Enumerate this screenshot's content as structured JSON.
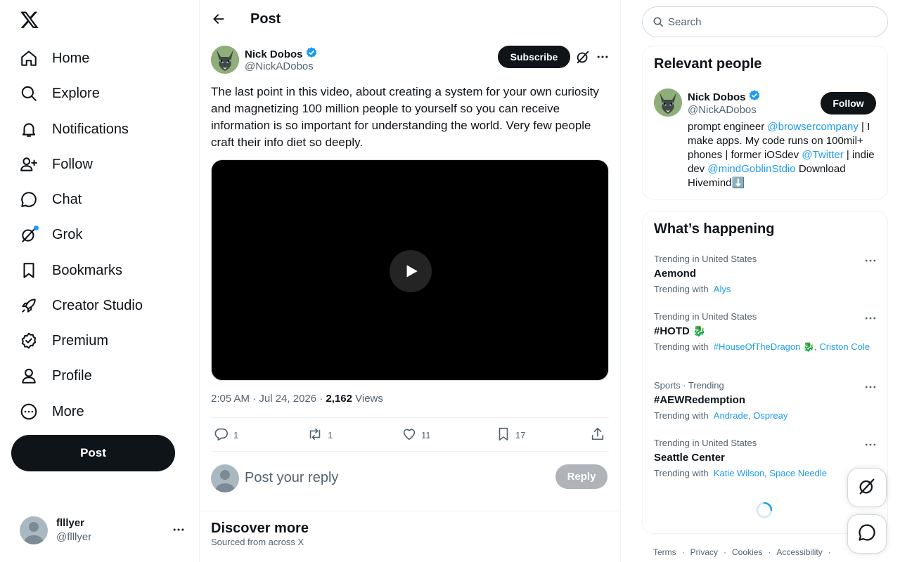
{
  "nav": {
    "logo": "x-logo",
    "items": [
      {
        "label": "Home",
        "icon": "home-icon"
      },
      {
        "label": "Explore",
        "icon": "search-icon"
      },
      {
        "label": "Notifications",
        "icon": "bell-icon"
      },
      {
        "label": "Follow",
        "icon": "person-add-icon"
      },
      {
        "label": "Chat",
        "icon": "chat-icon"
      },
      {
        "label": "Grok",
        "icon": "grok-icon"
      },
      {
        "label": "Bookmarks",
        "icon": "bookmark-icon"
      },
      {
        "label": "Creator Studio",
        "icon": "rocket-icon"
      },
      {
        "label": "Premium",
        "icon": "verified-badge-icon"
      },
      {
        "label": "Profile",
        "icon": "person-icon"
      },
      {
        "label": "More",
        "icon": "more-circle-icon"
      }
    ],
    "post_button": "Post"
  },
  "account": {
    "display_name": "flllyer",
    "handle": "@flllyer"
  },
  "header": {
    "title": "Post"
  },
  "post": {
    "author_name": "Nick Dobos",
    "author_handle": "@NickADobos",
    "subscribe_label": "Subscribe",
    "text": "The last point in this video, about creating a system for your own curiosity and magnetizing 100 million people to yourself so you can receive information is so important for understanding the world. Very few people craft their info diet so deeply.",
    "time": "2:05 AM · Jul 24, 2026 · ",
    "views_count": "2,162",
    "views_label": " Views",
    "actions": {
      "replies": "1",
      "reposts": "1",
      "likes": "11",
      "bookmarks": "17"
    }
  },
  "reply": {
    "placeholder": "Post your reply",
    "button": "Reply"
  },
  "discover": {
    "title": "Discover more",
    "subtitle": "Sourced from across X"
  },
  "search": {
    "placeholder": "Search"
  },
  "relevant": {
    "title": "Relevant people",
    "name": "Nick Dobos",
    "handle": "@NickADobos",
    "follow_label": "Follow",
    "bio": {
      "t1": "prompt engineer ",
      "m1": "@browsercompany",
      "t2": " | I make apps. My code runs on 100mil+ phones | former iOSdev ",
      "m2": "@Twitter",
      "t3": " | indie dev ",
      "m3": "@mindGoblinStdio",
      "t4": " Download Hivemind⬇️"
    }
  },
  "happening": {
    "title": "What’s happening",
    "trends": [
      {
        "context": "Trending in United States",
        "name": "Aemond",
        "with_label": "Trending with",
        "links": [
          "Alys"
        ]
      },
      {
        "context": "Trending in United States",
        "name": "#HOTD 🐉",
        "with_label": "Trending with",
        "links": [
          "#HouseOfTheDragon 🐉",
          "Criston Cole"
        ]
      },
      {
        "context": "Sports · Trending",
        "name": "#AEWRedemption",
        "with_label": "Trending with",
        "links": [
          "Andrade",
          "Ospreay"
        ]
      },
      {
        "context": "Trending in United States",
        "name": "Seattle Center",
        "with_label": "Trending with",
        "links": [
          "Katie Wilson",
          "Space Needle"
        ]
      }
    ]
  },
  "footer": {
    "links": [
      "Terms",
      "·",
      "Privacy",
      "·",
      "Cookies",
      "·",
      "Accessibility",
      "·"
    ]
  },
  "colors": {
    "accent": "#1d9bf0",
    "text": "#0f1419",
    "muted": "#536471",
    "border": "#eff3f4"
  }
}
